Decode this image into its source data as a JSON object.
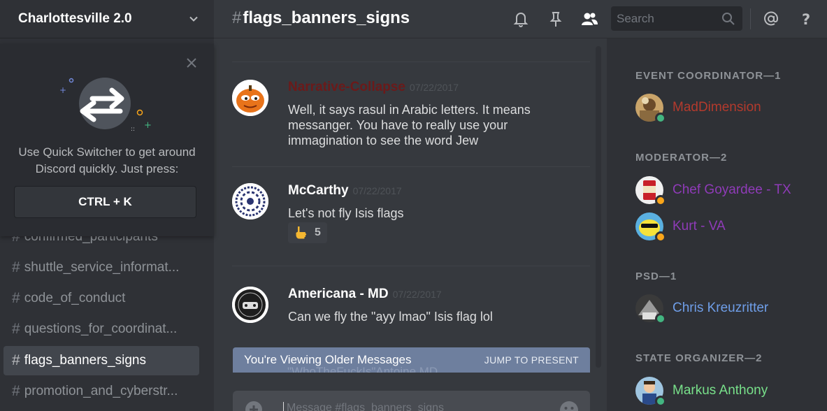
{
  "server": {
    "name": "Charlottesville 2.0"
  },
  "quick_switcher": {
    "tip": "Use Quick Switcher to get around Discord quickly. Just press:",
    "shortcut": "CTRL + K"
  },
  "channels": [
    {
      "name": "confirmed_participants",
      "active": false
    },
    {
      "name": "shuttle_service_informat...",
      "active": false
    },
    {
      "name": "code_of_conduct",
      "active": false
    },
    {
      "name": "questions_for_coordinat...",
      "active": false
    },
    {
      "name": "flags_banners_signs",
      "active": true
    },
    {
      "name": "promotion_and_cyberstr...",
      "active": false
    }
  ],
  "header": {
    "hash": "#",
    "channel": "flags_banners_signs",
    "search_placeholder": "Search",
    "icons": [
      "bell-icon",
      "pin-icon",
      "members-icon",
      "search-icon",
      "at-icon",
      "help-icon"
    ]
  },
  "messages": [
    {
      "author": "Narrative-Collapse",
      "author_color": "#6b1a1a",
      "timestamp": "07/22/2017",
      "text": "Well, it says rasul in Arabic letters. It means messanger. You have to really use your immagination to see the word Jew"
    },
    {
      "author": "McCarthy",
      "author_color": "#ffffff",
      "timestamp": "07/22/2017",
      "text": "Let's not fly Isis flags",
      "reaction": {
        "emoji": "point-up-emoji",
        "count": "5"
      }
    },
    {
      "author": "Americana - MD",
      "author_color": "#ffffff",
      "timestamp": "07/22/2017",
      "text": "Can we fly the \"ayy lmao\" Isis flag lol"
    }
  ],
  "older_bar": {
    "label": "You're Viewing Older Messages",
    "jump": "JUMP TO PRESENT",
    "ghost_text": "\"WhoTheFuckIs\"Antoine MD"
  },
  "composer": {
    "placeholder": "Message #flags_banners_signs"
  },
  "members": {
    "roles": [
      {
        "title": "EVENT COORDINATOR—1",
        "members": [
          {
            "name": "MadDimension",
            "color": "#b33a2d",
            "status": "online"
          }
        ]
      },
      {
        "title": "MODERATOR—2",
        "members": [
          {
            "name": "Chef Goyardee - TX",
            "color": "#8f3bb8",
            "status": "idle"
          },
          {
            "name": "Kurt - VA",
            "color": "#8f3bb8",
            "status": "idle"
          }
        ]
      },
      {
        "title": "PSD—1",
        "members": [
          {
            "name": "Chris Kreuzritter",
            "color": "#6f9ee8",
            "status": "online"
          }
        ]
      },
      {
        "title": "STATE ORGANIZER—2",
        "members": [
          {
            "name": "Markus Anthony",
            "color": "#78e08a",
            "status": "online"
          }
        ]
      }
    ],
    "status_colors": {
      "online": "#43b581",
      "idle": "#faa61a"
    }
  }
}
